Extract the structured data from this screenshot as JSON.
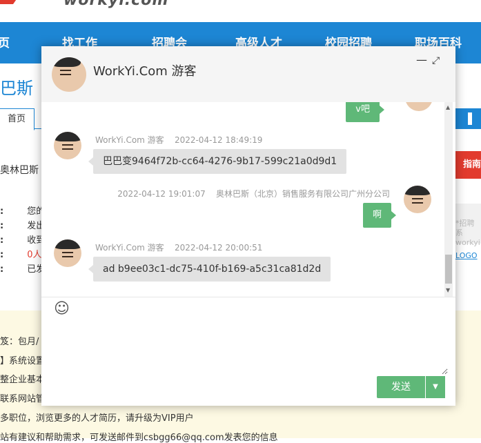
{
  "site": {
    "logo": "workyi.com"
  },
  "nav": {
    "items": [
      "页",
      "找工作",
      "招聘会",
      "高级人才",
      "校园招聘",
      "职场百科"
    ]
  },
  "company": {
    "name": "巴斯（",
    "tab_home": "首页",
    "short_name": "奥林巴斯",
    "red_button": "指南>>"
  },
  "left_panel": {
    "rows": [
      {
        "label": ":",
        "value": "您的"
      },
      {
        "label": ":",
        "value": "发出"
      },
      {
        "label": ":",
        "value": "收到"
      },
      {
        "label": ":",
        "value": "0人"
      },
      {
        "label": ":",
        "value": "已发"
      }
    ]
  },
  "right_panel": {
    "zhao_text": "*招聘系",
    "zhao_sub": "workyi.",
    "logo_link": "LOGO"
  },
  "notices": [
    "笈：包月/",
    "】系统设置",
    "整企业基本",
    "联系网站管",
    "多职位，浏览更多的人才简历，请升级为VIP用户",
    "站有建议和帮助需求，可发送邮件到csbgg66@qq.com发表您的信息"
  ],
  "chat": {
    "title": "WorkYi.Com 游客",
    "messages": [
      {
        "side": "right",
        "text": "v吧"
      },
      {
        "side": "left",
        "sender": "WorkYi.Com 游客",
        "time": "2022-04-12 18:49:19",
        "text": "巴巴变9464f72b-cc64-4276-9b17-599c21a0d9d1"
      },
      {
        "side": "right",
        "sender": "奥林巴斯（北京）销售服务有限公司广州分公司",
        "time": "2022-04-12 19:01:07",
        "text": "啊"
      },
      {
        "side": "left",
        "sender": "WorkYi.Com 游客",
        "time": "2022-04-12 20:00:51",
        "text": "ad b9ee03c1-dc75-410f-b169-a5c31ca81d2d"
      }
    ],
    "input_value": "",
    "send_label": "发送"
  },
  "colors": {
    "nav_blue": "#1d86d4",
    "send_green": "#5fb878",
    "accent_red": "#e23b2e",
    "cream": "#fdf9e3"
  },
  "icons": [
    "minimize-icon",
    "maximize-icon",
    "emoji-icon",
    "dropdown-arrow-icon",
    "scroll-up-icon",
    "scroll-down-icon"
  ]
}
